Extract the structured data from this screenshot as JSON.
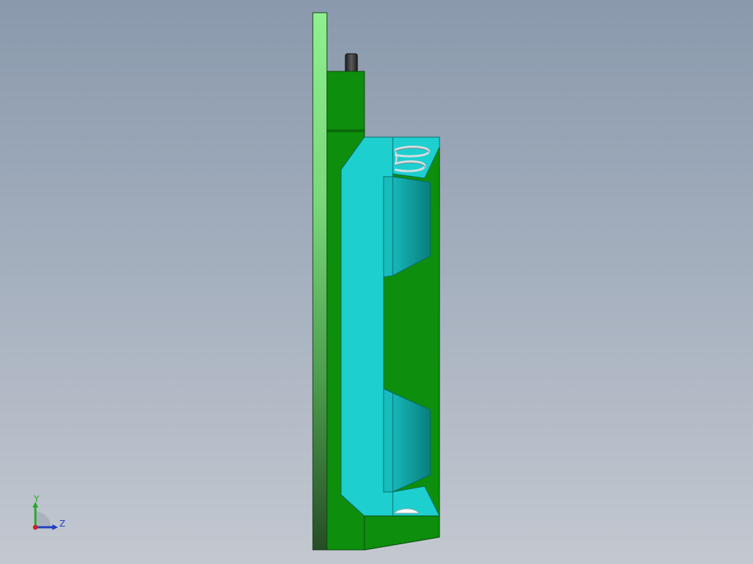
{
  "viewport": {
    "background_top": "#8a99ad",
    "background_bottom": "#c3c8d0"
  },
  "model": {
    "pcb_color": "#2f8a2f",
    "pcb_highlight": "#8ef08e",
    "holder_color": "#0d8e0d",
    "battery_color": "#1ecfcf",
    "battery_shadow": "#0f8f8f",
    "pin_color": "#3a3a3a",
    "spring_color": "#d8dce0"
  },
  "triad": {
    "y_label": "Y",
    "z_label": "Z",
    "y_color": "#22aa22",
    "z_color": "#1f3fbf",
    "x_color": "#cc2222"
  }
}
